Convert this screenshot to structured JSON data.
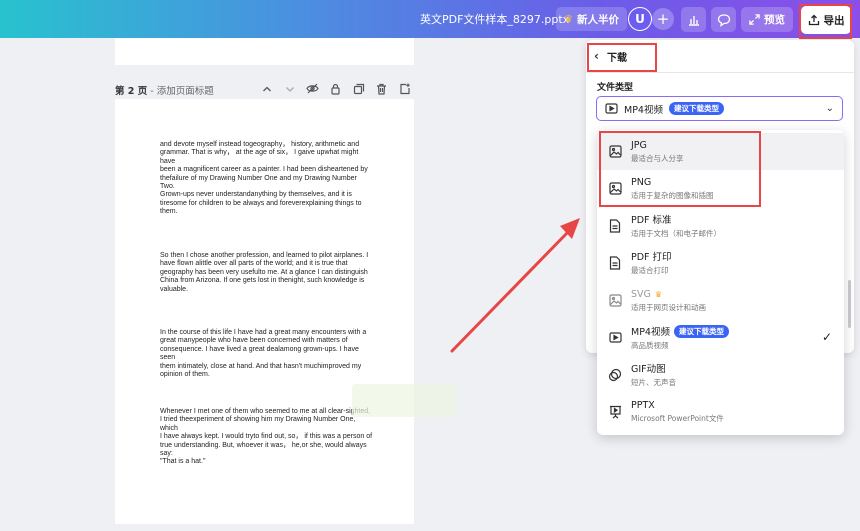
{
  "header": {
    "doc_title": "英文PDF文件样本_8297.pptx",
    "promo_label": "新人半价",
    "avatar_initial": "U",
    "plus_symbol": "+",
    "preview_label": "预览",
    "export_label": "导出"
  },
  "page": {
    "label_bold": "第 2 页",
    "label_sub": " - 添加页面标题",
    "paragraphs": [
      "and devote myself instead togeography， history, arithmetic and\ngrammar. That is why， at the age of six， I gaive upwhat might\nhave\nbeen a magnificent career as a painter. I had been disheartened by\nthefailure of my Drawing Number One and my Drawing Number\nTwo.\nGrown-ups never understandanything by themselves, and it is\ntiresome for children to be always and foreverexplaining things to\nthem.",
      "So then I chose another profession, and learned to pilot airplanes. I\nhave flown alittle over all parts of the world; and it is true that\ngeography has been very usefulto me. At a glance I can distinguish\nChina from Arizona. If one gets lost in thenight, such knowledge is\nvaluable.",
      "In the course of this life I have had a great many encounters with a\ngreat manypeople who have been concerned with matters of\nconsequence. I have lived a great dealamong grown-ups. I have\nseen\nthem intimately, close at hand. And that hasn't muchimproved my\nopinion of them.",
      "Whenever I met one of them who seemed to me at all clear-sighted,\nI tried theexperiment of showing him my Drawing Number One,\nwhich\nI have always kept. I would tryto find out, so， if this was a person of\ntrue understanding. But, whoever it was， he,or she, would always\nsay:\n\"That is a hat.\""
    ]
  },
  "export_panel": {
    "back_label": "下载",
    "file_type_label": "文件类型",
    "selected": {
      "name": "MP4视频",
      "badge": "建议下载类型"
    },
    "options": [
      {
        "name": "JPG",
        "desc": "最适合与人分享",
        "icon": "image-icon"
      },
      {
        "name": "PNG",
        "desc": "适用于复杂的图像和插图",
        "icon": "image-icon"
      },
      {
        "name": "PDF 标准",
        "desc": "适用于文档（和电子邮件）",
        "icon": "document-icon"
      },
      {
        "name": "PDF 打印",
        "desc": "最适合打印",
        "icon": "document-icon"
      },
      {
        "name": "SVG",
        "desc": "适用于网页设计和动画",
        "icon": "image-icon"
      },
      {
        "name": "MP4视频",
        "desc": "高品质视频",
        "badge": "建议下载类型",
        "icon": "video-icon"
      },
      {
        "name": "GIF动图",
        "desc": "短片、无声音",
        "icon": "gif-icon"
      },
      {
        "name": "PPTX",
        "desc": "Microsoft PowerPoint文件",
        "icon": "presentation-icon"
      }
    ]
  },
  "colors": {
    "accent": "#6b5ce8",
    "badge": "#3b63f4",
    "annotation": "#e84646"
  }
}
